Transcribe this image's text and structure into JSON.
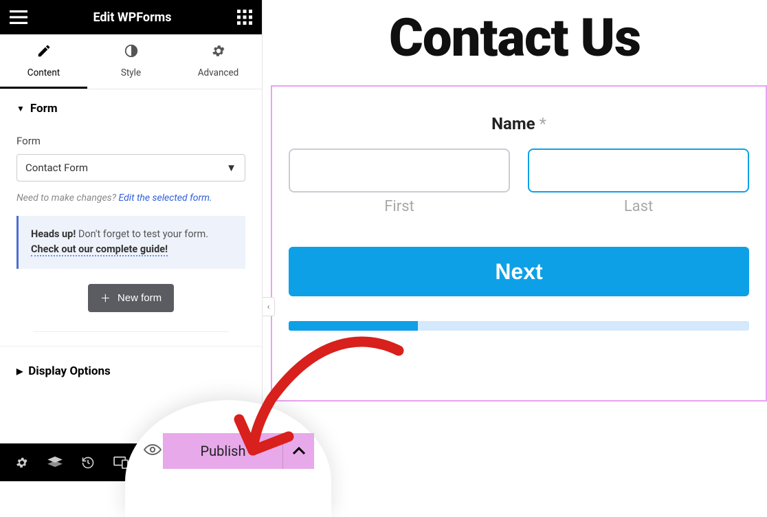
{
  "header": {
    "title": "Edit WPForms"
  },
  "tabs": [
    {
      "label": "Content",
      "active": true
    },
    {
      "label": "Style",
      "active": false
    },
    {
      "label": "Advanced",
      "active": false
    }
  ],
  "sections": {
    "form": {
      "title": "Form",
      "field_label": "Form",
      "selected": "Contact Form",
      "help_prefix": "Need to make changes? ",
      "help_link": "Edit the selected form.",
      "notice_strong": "Heads up!",
      "notice_text": " Don't forget to test your form. ",
      "notice_guide": "Check out our complete guide!",
      "new_form": "New form"
    },
    "display_options": {
      "title": "Display Options"
    }
  },
  "publish": {
    "label": "Publish"
  },
  "canvas": {
    "heading": "Contact Us",
    "name_label": "Name",
    "first": "First",
    "last": "Last",
    "next": "Next"
  }
}
